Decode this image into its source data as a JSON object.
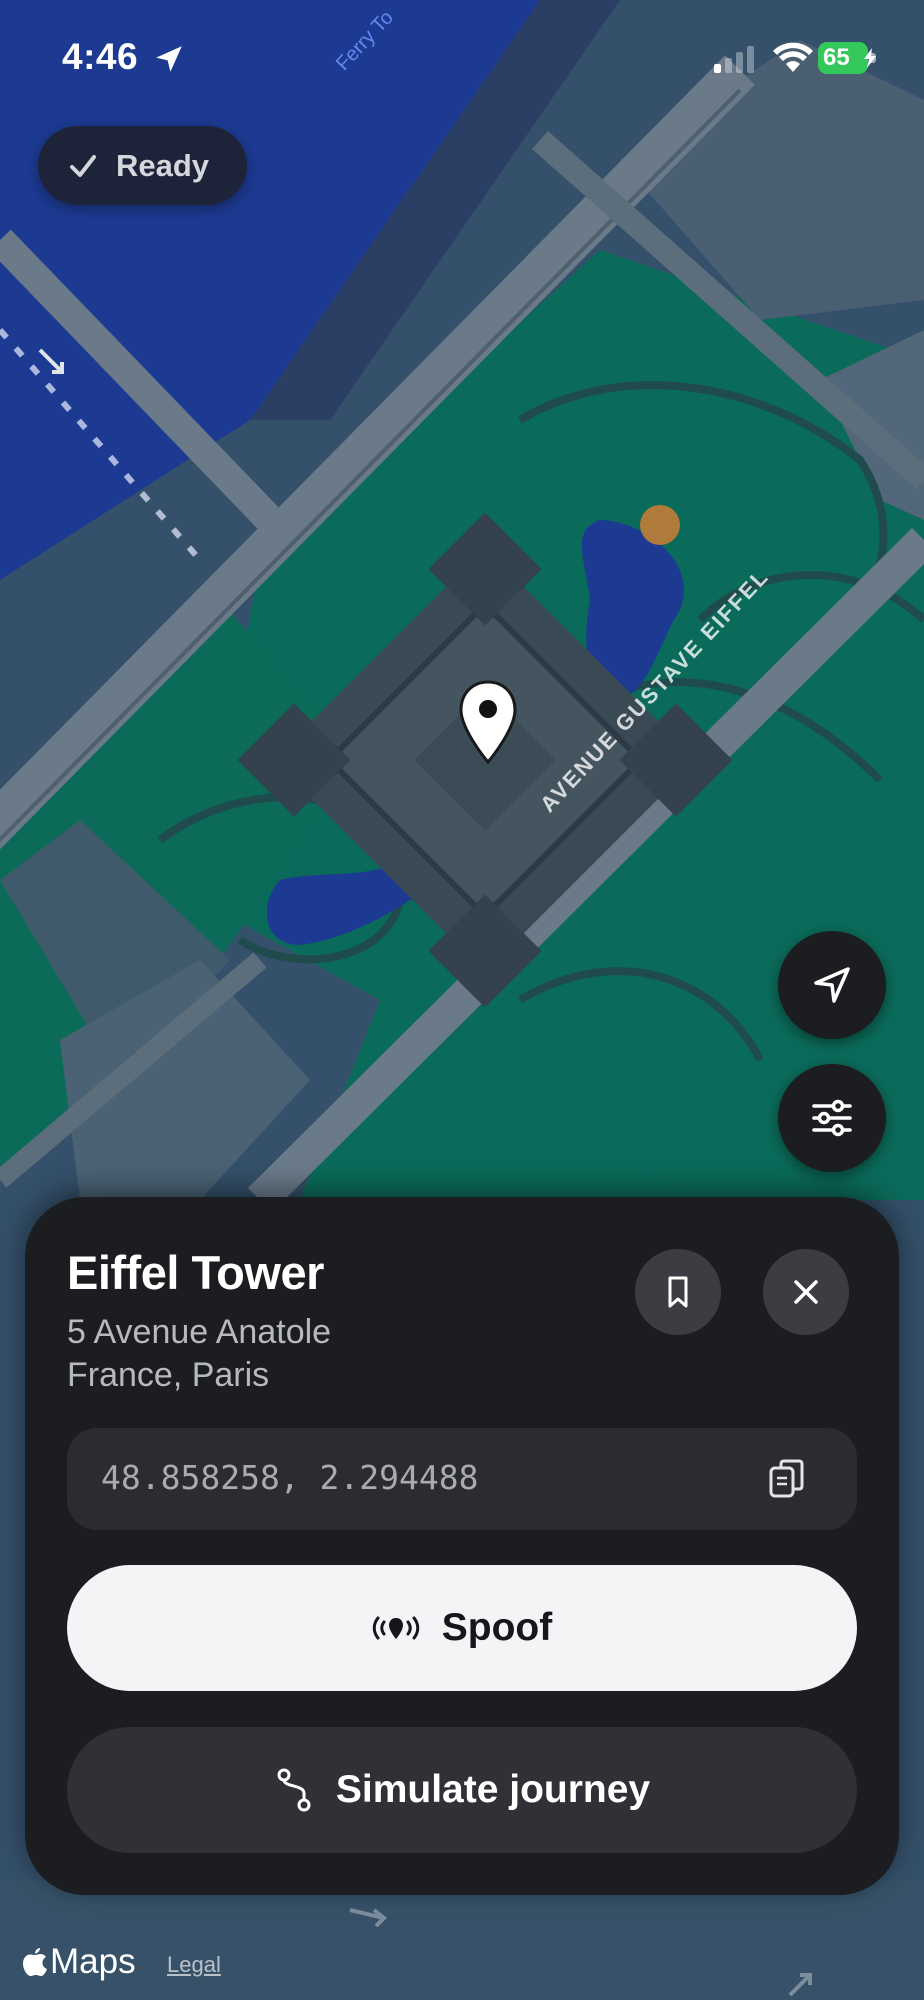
{
  "status_bar": {
    "time": "4:46",
    "location_icon": "location-arrow-icon",
    "signal_icon": "cellular-signal-icon",
    "wifi_icon": "wifi-icon",
    "battery_level": "65",
    "battery_color": "#34c759"
  },
  "map": {
    "status_pill": {
      "label": "Ready",
      "icon": "checkmark-icon"
    },
    "labels": {
      "street": "AVENUE GUSTAVE EIFFEL",
      "ferry": "Ferry To"
    },
    "controls": [
      {
        "icon": "navigation-arrow-icon"
      },
      {
        "icon": "sliders-icon"
      }
    ],
    "colors": {
      "park": "#0b6b5a",
      "water": "#1c3a92",
      "buildings": "#4a5f71",
      "roads": "#5a6c7c"
    }
  },
  "place": {
    "title": "Eiffel Tower",
    "address_line1": "5 Avenue Anatole",
    "address_line2": "France, Paris",
    "coordinates": "48.858258, 2.294488",
    "bookmark_icon": "bookmark-icon",
    "close_icon": "close-icon",
    "copy_icon": "copy-icon"
  },
  "actions": {
    "spoof_label": "Spoof",
    "spoof_icon": "broadcast-icon",
    "journey_label": "Simulate journey",
    "journey_icon": "route-icon"
  },
  "attribution": {
    "brand": "Maps",
    "legal": "Legal"
  }
}
